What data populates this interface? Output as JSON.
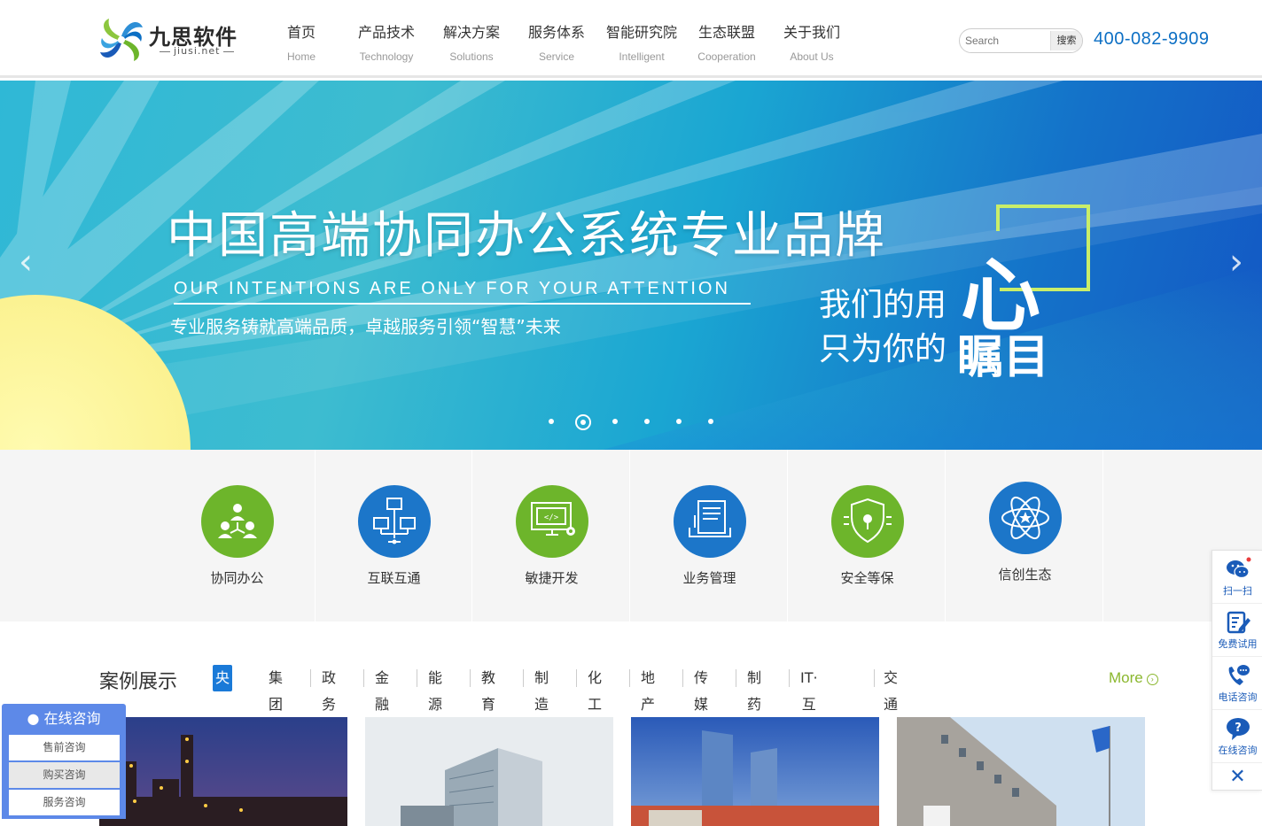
{
  "header": {
    "logo_name": "九思软件",
    "logo_sub": "jiusi.net",
    "nav": [
      {
        "cn": "首页",
        "en": "Home"
      },
      {
        "cn": "产品技术",
        "en": "Technology"
      },
      {
        "cn": "解决方案",
        "en": "Solutions"
      },
      {
        "cn": "服务体系",
        "en": "Service"
      },
      {
        "cn": "智能研究院",
        "en": "Intelligent"
      },
      {
        "cn": "生态联盟",
        "en": "Cooperation"
      },
      {
        "cn": "关于我们",
        "en": "About Us"
      }
    ],
    "search_placeholder": "Search",
    "search_button": "搜索",
    "phone": "400-082-9909"
  },
  "banner": {
    "title": "中国高端协同办公系统专业品牌",
    "en": "OUR INTENTIONS ARE ONLY FOR YOUR ATTENTION",
    "sub": "专业服务铸就高端品质，卓越服务引领“智慧”未来",
    "right_line1": "我们的用",
    "right_big1": "心",
    "right_line2": "只为你的",
    "right_big2": "瞩目",
    "prev": "‹",
    "next": "›",
    "active_slide": 2,
    "slide_count": 6
  },
  "features": [
    {
      "label": "协同办公",
      "color": "#6db52b",
      "icon": "people-network-icon"
    },
    {
      "label": "互联互通",
      "color": "#1c76c9",
      "icon": "connected-computers-icon"
    },
    {
      "label": "敏捷开发",
      "color": "#6db52b",
      "icon": "code-monitor-icon"
    },
    {
      "label": "业务管理",
      "color": "#1c76c9",
      "icon": "document-tray-icon"
    },
    {
      "label": "安全等保",
      "color": "#6db52b",
      "icon": "shield-icon"
    },
    {
      "label": "信创生态",
      "color": "#1c76c9",
      "icon": "atom-icon"
    }
  ],
  "cases": {
    "title": "案例展示",
    "tabs": [
      "央企",
      "集团",
      "政务",
      "金融",
      "能源",
      "教育",
      "制造",
      "化工",
      "地产",
      "传媒",
      "制药",
      "IT·互联网",
      "交通"
    ],
    "active_tab": 0,
    "more": "More",
    "more_icon": "›"
  },
  "consult": {
    "title": "在线咨询",
    "items": [
      "售前咨询",
      "购买咨询",
      "服务咨询"
    ]
  },
  "float_bar": {
    "items": [
      {
        "label": "扫一扫",
        "icon": "wechat-icon"
      },
      {
        "label": "免费试用",
        "icon": "edit-form-icon"
      },
      {
        "label": "电话咨询",
        "icon": "phone-chat-icon"
      },
      {
        "label": "在线咨询",
        "icon": "question-bubble-icon"
      }
    ],
    "close": "✕"
  }
}
